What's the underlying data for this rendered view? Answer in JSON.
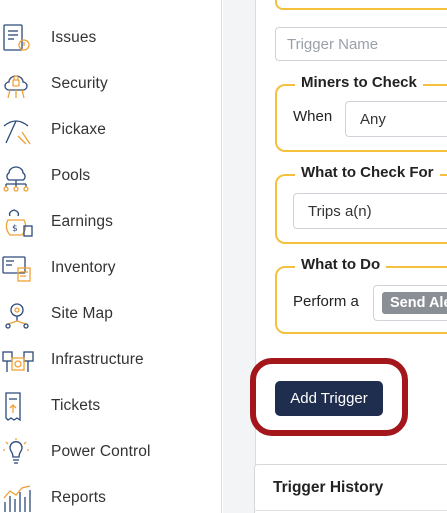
{
  "sidebar": {
    "items": [
      {
        "label": "Issues",
        "icon": "issues-icon"
      },
      {
        "label": "Security",
        "icon": "security-icon"
      },
      {
        "label": "Pickaxe",
        "icon": "pickaxe-icon"
      },
      {
        "label": "Pools",
        "icon": "pools-icon"
      },
      {
        "label": "Earnings",
        "icon": "earnings-icon"
      },
      {
        "label": "Inventory",
        "icon": "inventory-icon"
      },
      {
        "label": "Site Map",
        "icon": "site-map-icon"
      },
      {
        "label": "Infrastructure",
        "icon": "infrastructure-icon"
      },
      {
        "label": "Tickets",
        "icon": "tickets-icon"
      },
      {
        "label": "Power Control",
        "icon": "power-control-icon"
      },
      {
        "label": "Reports",
        "icon": "reports-icon"
      }
    ]
  },
  "form": {
    "trigger_name_placeholder": "Trigger Name",
    "miners": {
      "legend": "Miners to Check",
      "when_label": "When",
      "when_value": "Any"
    },
    "check_for": {
      "legend": "What to Check For",
      "value": "Trips a(n)"
    },
    "action": {
      "legend": "What to Do",
      "perform_label": "Perform a",
      "tag": "Send Ale"
    },
    "add_button": "Add Trigger"
  },
  "history": {
    "title": "Trigger History"
  },
  "colors": {
    "accent": "#f5c13c",
    "icon_blue": "#2c4a7a",
    "icon_orange": "#f0a136",
    "button": "#1f2d4e",
    "highlight": "#a3161b"
  }
}
